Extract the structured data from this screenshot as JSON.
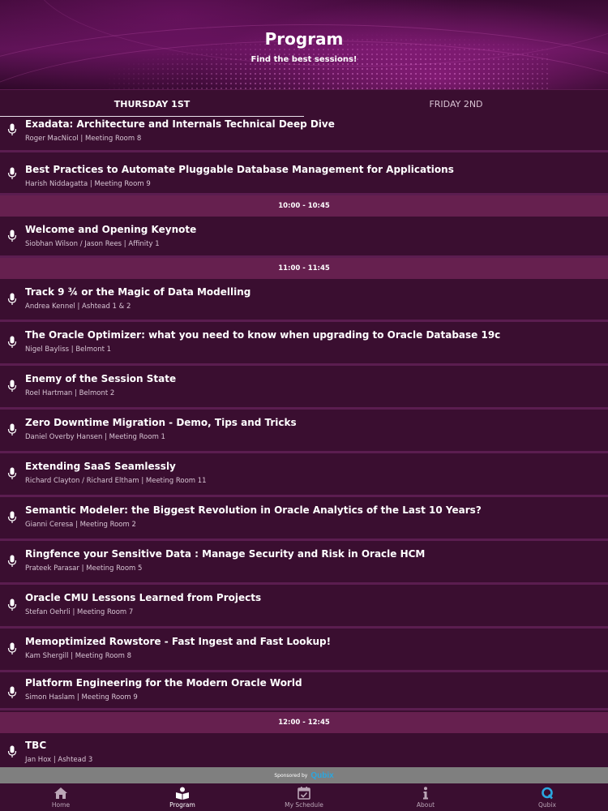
{
  "header": {
    "title": "Program",
    "subtitle": "Find the best sessions!"
  },
  "tabs": [
    {
      "label": "THURSDAY 1ST",
      "active": true
    },
    {
      "label": "FRIDAY 2ND",
      "active": false
    }
  ],
  "sessions_a": [
    {
      "title": "Exadata: Architecture and Internals Technical Deep Dive",
      "meta": "Roger MacNicol | Meeting Room 8"
    },
    {
      "title": "Best Practices to Automate Pluggable Database Management for Applications",
      "meta": "Harish Niddagatta | Meeting Room 9"
    }
  ],
  "slot_1": "10:00 - 10:45",
  "sessions_b": [
    {
      "title": "Welcome and Opening Keynote",
      "meta": "Siobhan Wilson / Jason Rees | Affinity 1"
    }
  ],
  "slot_2": "11:00 - 11:45",
  "sessions_c": [
    {
      "title": "Track 9 ¾ or the Magic of Data Modelling",
      "meta": "Andrea Kennel | Ashtead 1 & 2"
    },
    {
      "title": "The Oracle Optimizer: what you need to know when upgrading to Oracle Database 19c",
      "meta": "Nigel Bayliss | Belmont 1"
    },
    {
      "title": "Enemy of the Session State",
      "meta": "Roel Hartman | Belmont 2"
    },
    {
      "title": "Zero Downtime Migration - Demo, Tips and Tricks",
      "meta": "Daniel Overby Hansen | Meeting Room 1"
    },
    {
      "title": "Extending SaaS Seamlessly",
      "meta": "Richard Clayton / Richard Eltham | Meeting Room 11"
    },
    {
      "title": "Semantic Modeler: the Biggest Revolution in Oracle Analytics of the Last 10 Years?",
      "meta": "Gianni Ceresa | Meeting Room 2"
    },
    {
      "title": "Ringfence your Sensitive Data : Manage Security and Risk in Oracle HCM",
      "meta": "Prateek Parasar | Meeting Room 5"
    },
    {
      "title": "Oracle CMU Lessons Learned from Projects",
      "meta": "Stefan Oehrli | Meeting Room 7"
    },
    {
      "title": "Memoptimized Rowstore - Fast Ingest and Fast Lookup!",
      "meta": "Kam Shergill | Meeting Room 8"
    },
    {
      "title": "Platform Engineering for the Modern Oracle World",
      "meta": "Simon Haslam | Meeting Room 9"
    }
  ],
  "slot_3": "12:00 - 12:45",
  "sessions_d": [
    {
      "title": "TBC",
      "meta": "Jan Hox | Ashtead 3"
    }
  ],
  "sponsor": {
    "label": "Sponsored by",
    "brand": "Qubix"
  },
  "nav": [
    {
      "label": "Home",
      "icon": "home-icon"
    },
    {
      "label": "Program",
      "icon": "program-icon",
      "active": true
    },
    {
      "label": "My Schedule",
      "icon": "calendar-icon"
    },
    {
      "label": "About",
      "icon": "info-icon"
    },
    {
      "label": "Qubix",
      "icon": "qubix-icon"
    }
  ],
  "colors": {
    "background": "#3a0e30",
    "slot": "#66204f",
    "brand": "#2aa7e0"
  }
}
